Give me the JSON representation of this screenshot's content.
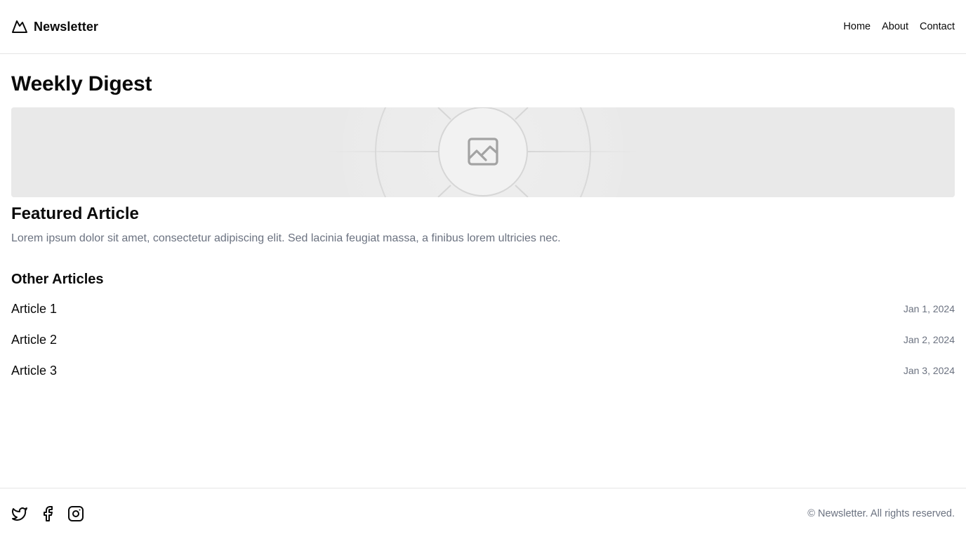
{
  "header": {
    "brand": "Newsletter",
    "brand_icon": "mountain-icon",
    "nav": [
      "Home",
      "About",
      "Contact"
    ]
  },
  "main": {
    "title": "Weekly Digest",
    "hero_icon": "image-placeholder-icon",
    "featured": {
      "title": "Featured Article",
      "description": "Lorem ipsum dolor sit amet, consectetur adipiscing elit. Sed lacinia feugiat massa, a finibus lorem ultricies nec."
    },
    "other": {
      "title": "Other Articles",
      "articles": [
        {
          "title": "Article 1",
          "date": "Jan 1, 2024"
        },
        {
          "title": "Article 2",
          "date": "Jan 2, 2024"
        },
        {
          "title": "Article 3",
          "date": "Jan 3, 2024"
        }
      ]
    }
  },
  "footer": {
    "socials": [
      "twitter-icon",
      "facebook-icon",
      "instagram-icon"
    ],
    "copyright": "© Newsletter. All rights reserved."
  },
  "colors": {
    "text": "#0a0a0a",
    "muted": "#6b7280",
    "border": "#e5e5e5",
    "placeholder_bg": "#e9e9e9"
  }
}
